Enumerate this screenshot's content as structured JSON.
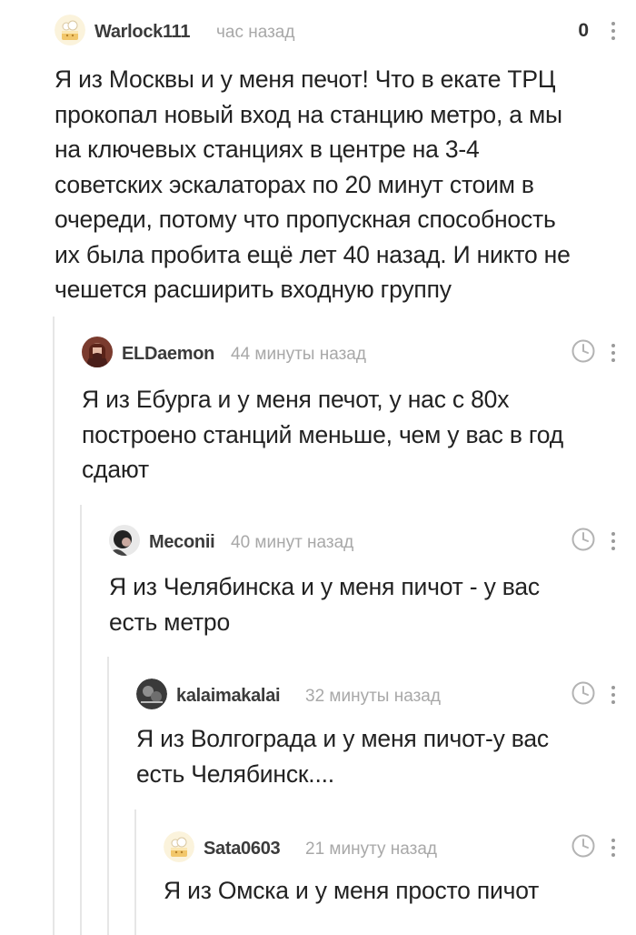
{
  "comments": [
    {
      "author": "Warlock111",
      "time": "час назад",
      "rating": "0",
      "text": "Я из Москвы и у меня печот! Что в екате ТРЦ прокопал новый вход на станцию метро, а мы на ключевых станциях в центре на 3-4 советских эскалаторах по 20 минут стоим в очереди, потому что пропускная способность их была пробита ещё лет 40 назад. И никто не чешется расширить входную группу",
      "lines": [
        "Я из Москвы и у меня печот! Что в екате ТРЦ",
        "прокопал новый вход на станцию метро, а мы",
        "на ключевых станциях в центре на 3-4",
        "советских эскалаторах по 20 минут стоим в",
        "очереди, потому что пропускная способность",
        "их была пробита ещё лет 40 назад. И никто не",
        "чешется расширить входную группу"
      ]
    },
    {
      "author": "ELDaemon",
      "time": "44 минуты назад",
      "lines": [
        "Я из Ебурга и у меня печот, у нас с 80х",
        "построено станций меньше, чем у вас в год",
        "сдают"
      ]
    },
    {
      "author": "Meconii",
      "time": "40 минут назад",
      "lines": [
        "Я из Челябинска и у меня пичот - у вас",
        "есть метро"
      ]
    },
    {
      "author": "kalaimakalai",
      "time": "32 минуты назад",
      "lines": [
        "Я из Волгограда и у меня пичот-у вас",
        "есть Челябинск...."
      ]
    },
    {
      "author": "Sata0603",
      "time": "21 минуту назад",
      "lines": [
        "Я из Омска и у меня просто пичот"
      ]
    }
  ],
  "icons": {
    "default_avatar": "cat-cake-avatar-icon",
    "clock": "clock-icon",
    "menu": "more-dots-icon"
  },
  "colors": {
    "author": "#3b3b3b",
    "time": "#a8a8a8",
    "thread_line": "#e6e6e6",
    "text": "#222222"
  }
}
